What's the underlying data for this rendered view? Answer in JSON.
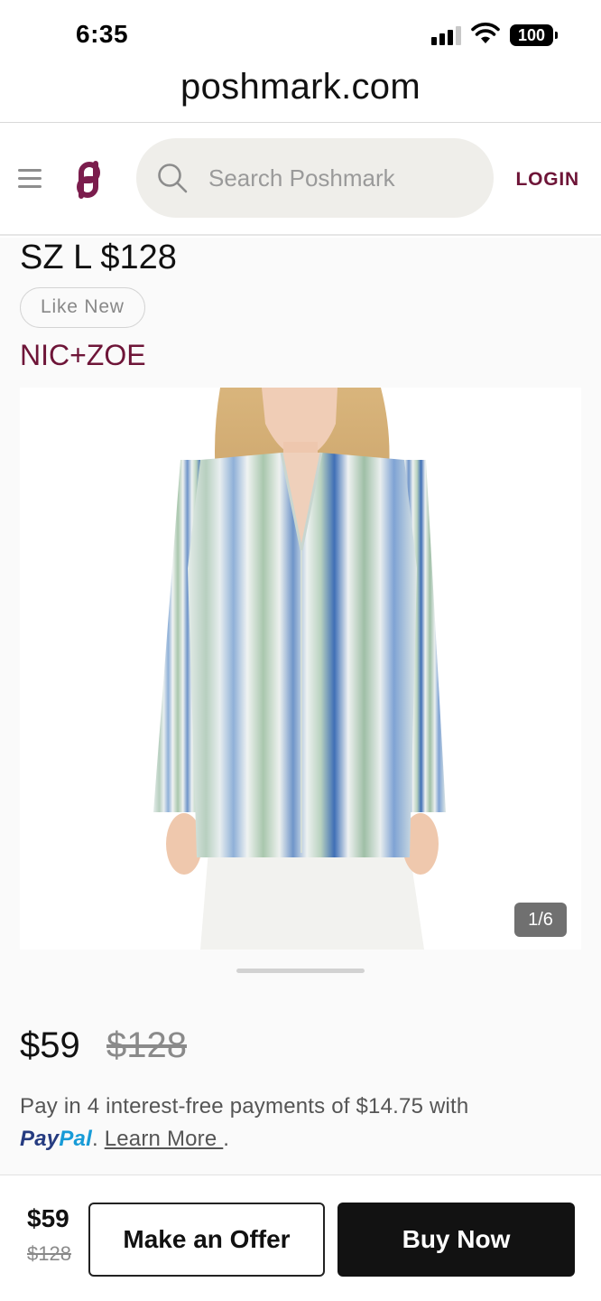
{
  "status_bar": {
    "time": "6:35",
    "battery": "100",
    "icons": [
      "cellular-signal-icon",
      "wifi-icon",
      "battery-icon"
    ]
  },
  "browser": {
    "url": "poshmark.com"
  },
  "header": {
    "menu_icon": "hamburger-menu-icon",
    "logo_icon": "poshmark-logo-icon",
    "search_placeholder": "Search Poshmark",
    "search_icon": "search-icon",
    "login_label": "LOGIN"
  },
  "listing": {
    "size_price": "SZ L $128",
    "condition": "Like New",
    "brand": "NIC+ZOE",
    "image_counter": "1/6",
    "price": "$59",
    "original_price": "$128",
    "payment_text": "Pay in 4 interest-free payments of $14.75 with",
    "paypal_pay": "Pay",
    "paypal_pal": "Pal",
    "learn_more": "Learn More ",
    "period": "."
  },
  "bottom_bar": {
    "price": "$59",
    "original_price": "$128",
    "offer_label": "Make an Offer",
    "buy_label": "Buy Now"
  },
  "colors": {
    "brand": "#6e1538",
    "search_bg": "#efeeea",
    "buy_button_bg": "#121212",
    "paypal_dark": "#253b80",
    "paypal_light": "#179bd7"
  }
}
